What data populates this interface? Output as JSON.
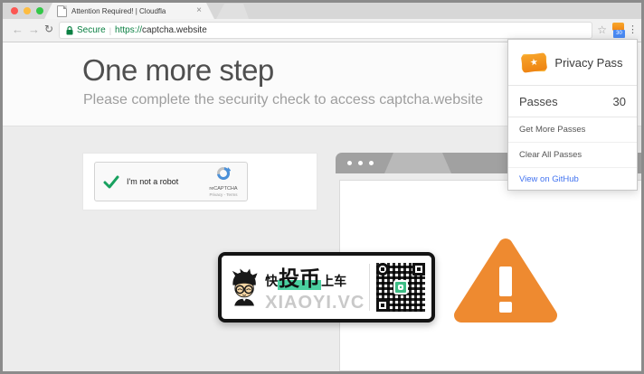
{
  "browser": {
    "tab_title": "Attention Required! | Cloudfla",
    "secure_label": "Secure",
    "url_sep": "|",
    "url_scheme": "https://",
    "url_host": "captcha.website",
    "extension_badge": "30"
  },
  "icons": {
    "back": "←",
    "forward": "→",
    "reload": "↻",
    "bookmark_star": "☆",
    "menu_dots": "⋮",
    "tab_close": "×",
    "ticket_star": "★"
  },
  "page": {
    "heading": "One more step",
    "subheading": "Please complete the security check to access captcha.website"
  },
  "captcha": {
    "label": "I'm not a robot",
    "brand": "reCAPTCHA",
    "links": "Privacy - Terms"
  },
  "privacy_pass": {
    "title": "Privacy Pass",
    "passes_label": "Passes",
    "passes_count": "30",
    "items": [
      "Get More Passes",
      "Clear All Passes"
    ],
    "github_link": "View on GitHub"
  },
  "watermark": {
    "prefix": "快",
    "highlight": "投币",
    "suffix": "上车",
    "brand": "XIAOYI.VC"
  },
  "colors": {
    "warning_orange": "#ee8a30",
    "secure_green": "#0b8043",
    "link_blue": "#4273f0",
    "highlight_mint": "#4ad0a0",
    "badge_blue": "#4b8bf5"
  }
}
